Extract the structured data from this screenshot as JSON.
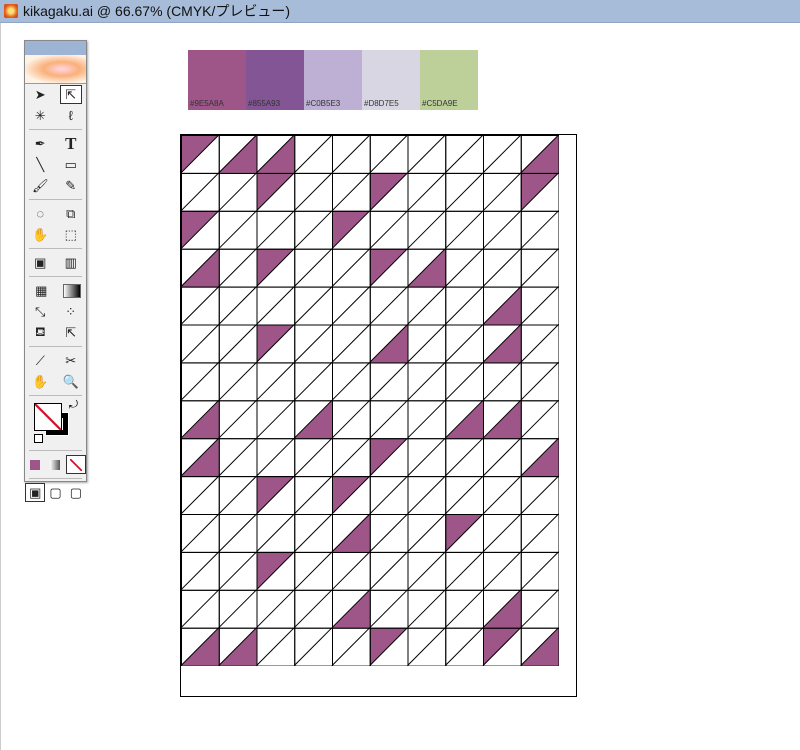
{
  "window": {
    "title": "kikagaku.ai @ 66.67% (CMYK/プレビュー)"
  },
  "toolbox": {
    "type_tool_label": "T"
  },
  "swatches": [
    {
      "label": "#9E5A8A",
      "color": "#9e5688"
    },
    {
      "label": "#855A93",
      "color": "#835594"
    },
    {
      "label": "#C0B5E3",
      "color": "#bdb0d4"
    },
    {
      "label": "#D8D7E5",
      "color": "#d8d6e2"
    },
    {
      "label": "#C5DA9E",
      "color": "#bdd09a"
    }
  ],
  "pattern": {
    "fill_color": "#9e5688",
    "columns": 10,
    "rows": 14,
    "filled_cells": [
      [
        0,
        0,
        "U"
      ],
      [
        0,
        1,
        "L"
      ],
      [
        0,
        2,
        "L"
      ],
      [
        0,
        9,
        "L"
      ],
      [
        1,
        2,
        "U"
      ],
      [
        1,
        5,
        "U"
      ],
      [
        1,
        9,
        "U"
      ],
      [
        2,
        0,
        "U"
      ],
      [
        2,
        4,
        "U"
      ],
      [
        3,
        0,
        "L"
      ],
      [
        3,
        2,
        "U"
      ],
      [
        3,
        5,
        "U"
      ],
      [
        3,
        6,
        "L"
      ],
      [
        4,
        8,
        "L"
      ],
      [
        5,
        2,
        "U"
      ],
      [
        5,
        5,
        "L"
      ],
      [
        5,
        8,
        "L"
      ],
      [
        7,
        0,
        "L"
      ],
      [
        7,
        3,
        "L"
      ],
      [
        7,
        7,
        "L"
      ],
      [
        7,
        8,
        "L"
      ],
      [
        8,
        0,
        "L"
      ],
      [
        8,
        5,
        "U"
      ],
      [
        8,
        9,
        "L"
      ],
      [
        9,
        2,
        "U"
      ],
      [
        9,
        4,
        "U"
      ],
      [
        10,
        4,
        "L"
      ],
      [
        10,
        7,
        "U"
      ],
      [
        11,
        2,
        "U"
      ],
      [
        12,
        4,
        "L"
      ],
      [
        12,
        8,
        "L"
      ],
      [
        13,
        0,
        "L"
      ],
      [
        13,
        1,
        "L"
      ],
      [
        13,
        5,
        "U"
      ],
      [
        13,
        8,
        "U"
      ],
      [
        13,
        9,
        "L"
      ]
    ]
  }
}
